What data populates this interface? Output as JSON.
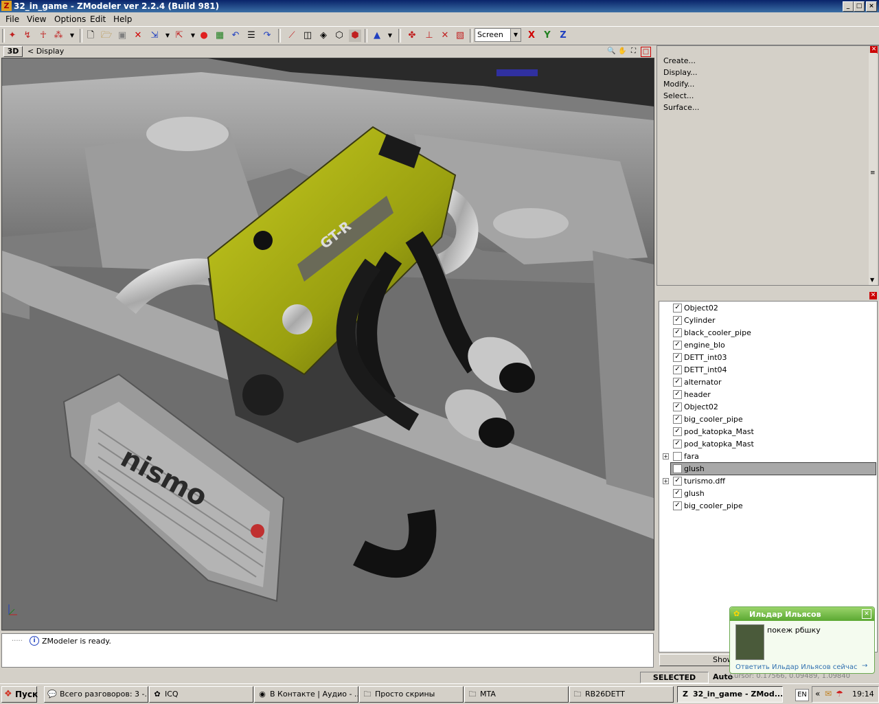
{
  "window": {
    "title": "32_in_game - ZModeler ver 2.2.4 (Build 981)",
    "minimize": "_",
    "restore": "□",
    "close": "×"
  },
  "menu": [
    "File",
    "View",
    "Options",
    "Edit",
    "Help"
  ],
  "toolbar": {
    "screen_value": "Screen",
    "axis_x": "X",
    "axis_y": "Y",
    "axis_z": "Z"
  },
  "viewport": {
    "mode_button": "3D",
    "breadcrumb": "<  Display",
    "decal_text": "nismo",
    "cover_text": "GT-R"
  },
  "commands": [
    "Create...",
    "Display...",
    "Modify...",
    "Select...",
    "Surface..."
  ],
  "objects": [
    {
      "name": "Object02",
      "checked": true,
      "expandable": false,
      "selected": false
    },
    {
      "name": "Cylinder",
      "checked": true,
      "expandable": false,
      "selected": false
    },
    {
      "name": "black_cooler_pipe",
      "checked": true,
      "expandable": false,
      "selected": false
    },
    {
      "name": "engine_blo",
      "checked": true,
      "expandable": false,
      "selected": false
    },
    {
      "name": "DETT_int03",
      "checked": true,
      "expandable": false,
      "selected": false
    },
    {
      "name": "DETT_int04",
      "checked": true,
      "expandable": false,
      "selected": false
    },
    {
      "name": "alternator",
      "checked": true,
      "expandable": false,
      "selected": false
    },
    {
      "name": "header",
      "checked": true,
      "expandable": false,
      "selected": false
    },
    {
      "name": "Object02",
      "checked": true,
      "expandable": false,
      "selected": false
    },
    {
      "name": "big_cooler_pipe",
      "checked": true,
      "expandable": false,
      "selected": false
    },
    {
      "name": "pod_katopka_Mast",
      "checked": true,
      "expandable": false,
      "selected": false
    },
    {
      "name": "pod_katopka_Mast",
      "checked": true,
      "expandable": false,
      "selected": false
    },
    {
      "name": "fara",
      "checked": false,
      "expandable": true,
      "selected": false
    },
    {
      "name": "glush",
      "checked": false,
      "expandable": false,
      "selected": true
    },
    {
      "name": "turismo.dff",
      "checked": true,
      "expandable": true,
      "selected": false
    },
    {
      "name": "glush",
      "checked": true,
      "expandable": false,
      "selected": false
    },
    {
      "name": "big_cooler_pipe",
      "checked": true,
      "expandable": false,
      "selected": false
    }
  ],
  "show_all_label": "Show all",
  "log": {
    "message": "ZModeler is ready."
  },
  "status": {
    "mode": "SELECTED MODE",
    "auto": "Auto",
    "cursor": "Cursor: 0.17566, 0.09489, 1.09840"
  },
  "notification": {
    "sender": "Ильдар Ильясов",
    "message": "покеж рбшку",
    "reply_link": "Ответить Ильдар Ильясов сейчас"
  },
  "taskbar": {
    "start": "Пуск",
    "tasks": [
      {
        "label": "Всего разговоров: 3 -...",
        "icon": "chat-icon",
        "active": false
      },
      {
        "label": "ICQ",
        "icon": "icq-icon",
        "active": false
      },
      {
        "label": "В Контакте | Аудио - ...",
        "icon": "firefox-icon",
        "active": false
      },
      {
        "label": "Просто скрины",
        "icon": "folder-icon",
        "active": false
      },
      {
        "label": "MTA",
        "icon": "folder-icon",
        "active": false
      },
      {
        "label": "RB26DETT",
        "icon": "folder-icon",
        "active": false
      },
      {
        "label": "32_in_game - ZMod...",
        "icon": "zmodeler-icon",
        "active": true
      }
    ],
    "lang": "EN",
    "clock": "19:14"
  }
}
